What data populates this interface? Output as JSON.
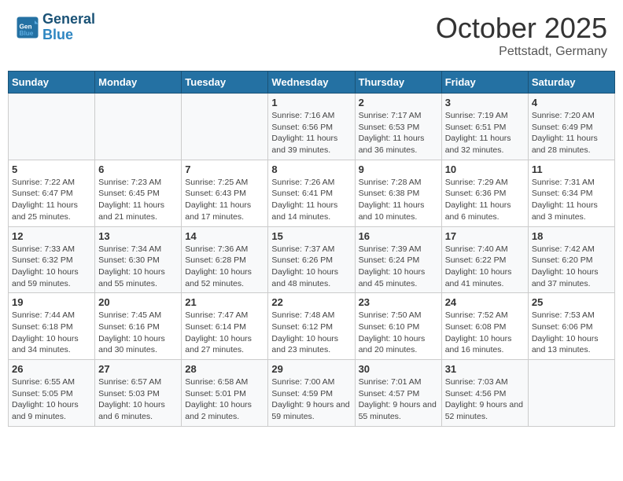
{
  "header": {
    "logo_line1": "General",
    "logo_line2": "Blue",
    "month": "October 2025",
    "location": "Pettstadt, Germany"
  },
  "days_of_week": [
    "Sunday",
    "Monday",
    "Tuesday",
    "Wednesday",
    "Thursday",
    "Friday",
    "Saturday"
  ],
  "weeks": [
    [
      {
        "day": "",
        "info": ""
      },
      {
        "day": "",
        "info": ""
      },
      {
        "day": "",
        "info": ""
      },
      {
        "day": "1",
        "info": "Sunrise: 7:16 AM\nSunset: 6:56 PM\nDaylight: 11 hours and 39 minutes."
      },
      {
        "day": "2",
        "info": "Sunrise: 7:17 AM\nSunset: 6:53 PM\nDaylight: 11 hours and 36 minutes."
      },
      {
        "day": "3",
        "info": "Sunrise: 7:19 AM\nSunset: 6:51 PM\nDaylight: 11 hours and 32 minutes."
      },
      {
        "day": "4",
        "info": "Sunrise: 7:20 AM\nSunset: 6:49 PM\nDaylight: 11 hours and 28 minutes."
      }
    ],
    [
      {
        "day": "5",
        "info": "Sunrise: 7:22 AM\nSunset: 6:47 PM\nDaylight: 11 hours and 25 minutes."
      },
      {
        "day": "6",
        "info": "Sunrise: 7:23 AM\nSunset: 6:45 PM\nDaylight: 11 hours and 21 minutes."
      },
      {
        "day": "7",
        "info": "Sunrise: 7:25 AM\nSunset: 6:43 PM\nDaylight: 11 hours and 17 minutes."
      },
      {
        "day": "8",
        "info": "Sunrise: 7:26 AM\nSunset: 6:41 PM\nDaylight: 11 hours and 14 minutes."
      },
      {
        "day": "9",
        "info": "Sunrise: 7:28 AM\nSunset: 6:38 PM\nDaylight: 11 hours and 10 minutes."
      },
      {
        "day": "10",
        "info": "Sunrise: 7:29 AM\nSunset: 6:36 PM\nDaylight: 11 hours and 6 minutes."
      },
      {
        "day": "11",
        "info": "Sunrise: 7:31 AM\nSunset: 6:34 PM\nDaylight: 11 hours and 3 minutes."
      }
    ],
    [
      {
        "day": "12",
        "info": "Sunrise: 7:33 AM\nSunset: 6:32 PM\nDaylight: 10 hours and 59 minutes."
      },
      {
        "day": "13",
        "info": "Sunrise: 7:34 AM\nSunset: 6:30 PM\nDaylight: 10 hours and 55 minutes."
      },
      {
        "day": "14",
        "info": "Sunrise: 7:36 AM\nSunset: 6:28 PM\nDaylight: 10 hours and 52 minutes."
      },
      {
        "day": "15",
        "info": "Sunrise: 7:37 AM\nSunset: 6:26 PM\nDaylight: 10 hours and 48 minutes."
      },
      {
        "day": "16",
        "info": "Sunrise: 7:39 AM\nSunset: 6:24 PM\nDaylight: 10 hours and 45 minutes."
      },
      {
        "day": "17",
        "info": "Sunrise: 7:40 AM\nSunset: 6:22 PM\nDaylight: 10 hours and 41 minutes."
      },
      {
        "day": "18",
        "info": "Sunrise: 7:42 AM\nSunset: 6:20 PM\nDaylight: 10 hours and 37 minutes."
      }
    ],
    [
      {
        "day": "19",
        "info": "Sunrise: 7:44 AM\nSunset: 6:18 PM\nDaylight: 10 hours and 34 minutes."
      },
      {
        "day": "20",
        "info": "Sunrise: 7:45 AM\nSunset: 6:16 PM\nDaylight: 10 hours and 30 minutes."
      },
      {
        "day": "21",
        "info": "Sunrise: 7:47 AM\nSunset: 6:14 PM\nDaylight: 10 hours and 27 minutes."
      },
      {
        "day": "22",
        "info": "Sunrise: 7:48 AM\nSunset: 6:12 PM\nDaylight: 10 hours and 23 minutes."
      },
      {
        "day": "23",
        "info": "Sunrise: 7:50 AM\nSunset: 6:10 PM\nDaylight: 10 hours and 20 minutes."
      },
      {
        "day": "24",
        "info": "Sunrise: 7:52 AM\nSunset: 6:08 PM\nDaylight: 10 hours and 16 minutes."
      },
      {
        "day": "25",
        "info": "Sunrise: 7:53 AM\nSunset: 6:06 PM\nDaylight: 10 hours and 13 minutes."
      }
    ],
    [
      {
        "day": "26",
        "info": "Sunrise: 6:55 AM\nSunset: 5:05 PM\nDaylight: 10 hours and 9 minutes."
      },
      {
        "day": "27",
        "info": "Sunrise: 6:57 AM\nSunset: 5:03 PM\nDaylight: 10 hours and 6 minutes."
      },
      {
        "day": "28",
        "info": "Sunrise: 6:58 AM\nSunset: 5:01 PM\nDaylight: 10 hours and 2 minutes."
      },
      {
        "day": "29",
        "info": "Sunrise: 7:00 AM\nSunset: 4:59 PM\nDaylight: 9 hours and 59 minutes."
      },
      {
        "day": "30",
        "info": "Sunrise: 7:01 AM\nSunset: 4:57 PM\nDaylight: 9 hours and 55 minutes."
      },
      {
        "day": "31",
        "info": "Sunrise: 7:03 AM\nSunset: 4:56 PM\nDaylight: 9 hours and 52 minutes."
      },
      {
        "day": "",
        "info": ""
      }
    ]
  ]
}
